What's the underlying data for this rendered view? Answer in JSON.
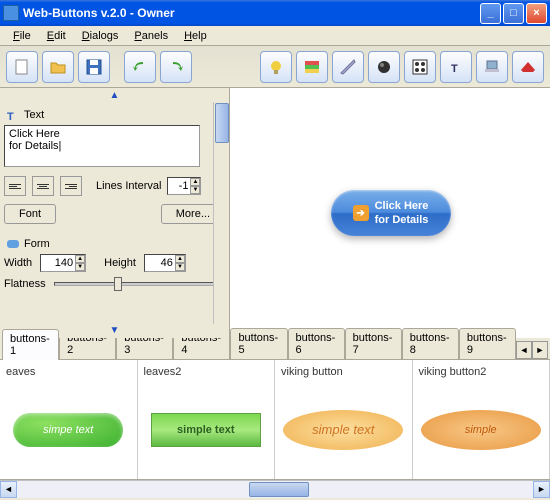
{
  "window": {
    "title": "Web-Buttons v.2.0  -  Owner"
  },
  "menu": {
    "file": "File",
    "edit": "Edit",
    "dialogs": "Dialogs",
    "panels": "Panels",
    "help": "Help"
  },
  "text_panel": {
    "header": "Text",
    "content": "Click Here\nfor Details|",
    "lines_interval_label": "Lines Interval",
    "lines_interval_value": "-1",
    "font_btn": "Font",
    "more_btn": "More..."
  },
  "form_panel": {
    "header": "Form",
    "width_label": "Width",
    "width_value": "140",
    "height_label": "Height",
    "height_value": "46",
    "flatness_label": "Flatness"
  },
  "preview": {
    "line1": "Click Here",
    "line2": "for Details"
  },
  "tabs": [
    "buttons-1",
    "buttons-2",
    "buttons-3",
    "buttons-4",
    "buttons-5",
    "buttons-6",
    "buttons-7",
    "buttons-8",
    "buttons-9"
  ],
  "gallery": [
    {
      "title": "eaves",
      "text": "simpe text"
    },
    {
      "title": "leaves2",
      "text": "simple text"
    },
    {
      "title": "viking button",
      "text": "simple text"
    },
    {
      "title": "viking button2",
      "text": "simple"
    }
  ]
}
